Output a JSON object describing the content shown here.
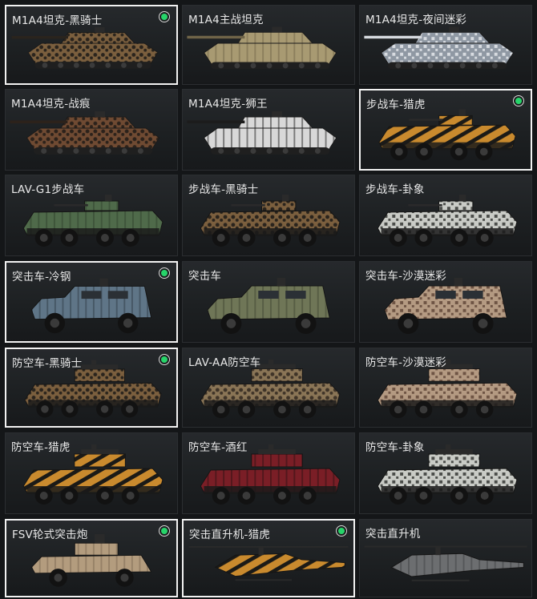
{
  "vehicles": [
    {
      "label": "M1A4坦克-黑骑士",
      "type": "tank",
      "camo": "desert-dark",
      "selected": true,
      "owned": true
    },
    {
      "label": "M1A4主战坦克",
      "type": "tank",
      "camo": "tan",
      "selected": false,
      "owned": false
    },
    {
      "label": "M1A4坦克-夜间迷彩",
      "type": "tank",
      "camo": "night",
      "selected": false,
      "owned": false
    },
    {
      "label": "M1A4坦克-战痕",
      "type": "tank",
      "camo": "scarred",
      "selected": false,
      "owned": false
    },
    {
      "label": "M1A4坦克-狮王",
      "type": "tank",
      "camo": "lion",
      "selected": false,
      "owned": false
    },
    {
      "label": "步战车-猎虎",
      "type": "ifv",
      "camo": "tiger",
      "selected": true,
      "owned": true
    },
    {
      "label": "LAV-G1步战车",
      "type": "ifv",
      "camo": "green",
      "selected": false,
      "owned": false
    },
    {
      "label": "步战车-黑骑士",
      "type": "ifv",
      "camo": "desert-dark",
      "selected": false,
      "owned": false
    },
    {
      "label": "步战车-卦象",
      "type": "ifv",
      "camo": "arctic",
      "selected": false,
      "owned": false
    },
    {
      "label": "突击车-冷钢",
      "type": "mrap",
      "camo": "steel",
      "selected": true,
      "owned": true
    },
    {
      "label": "突击车",
      "type": "mrap",
      "camo": "olive",
      "selected": false,
      "owned": false
    },
    {
      "label": "突击车-沙漠迷彩",
      "type": "mrap",
      "camo": "desert-digital",
      "selected": false,
      "owned": false
    },
    {
      "label": "防空车-黑骑士",
      "type": "aa",
      "camo": "desert-dark",
      "selected": true,
      "owned": true
    },
    {
      "label": "LAV-AA防空车",
      "type": "aa",
      "camo": "tan-worn",
      "selected": false,
      "owned": false
    },
    {
      "label": "防空车-沙漠迷彩",
      "type": "aa",
      "camo": "desert-digital",
      "selected": false,
      "owned": false
    },
    {
      "label": "防空车-猎虎",
      "type": "aa",
      "camo": "tiger",
      "selected": false,
      "owned": false
    },
    {
      "label": "防空车-酒红",
      "type": "aa",
      "camo": "wine",
      "selected": false,
      "owned": false
    },
    {
      "label": "防空车-卦象",
      "type": "aa",
      "camo": "arctic",
      "selected": false,
      "owned": false
    },
    {
      "label": "FSV轮式突击炮",
      "type": "fsv",
      "camo": "sand",
      "selected": true,
      "owned": true
    },
    {
      "label": "突击直升机-猎虎",
      "type": "heli",
      "camo": "tiger",
      "selected": true,
      "owned": true
    },
    {
      "label": "突击直升机",
      "type": "heli",
      "camo": "gray",
      "selected": false,
      "owned": false
    }
  ],
  "palette": {
    "selected_border": "#f2f2f2",
    "owned_dot": "#27d46a",
    "desert-dark": [
      "#7b5f3e",
      "#2a241d",
      "#a0845c"
    ],
    "tan": [
      "#a89a72",
      "#6f6448",
      "#cbbf98"
    ],
    "night": [
      "#8f98a3",
      "#d7dbe0",
      "#4a5058"
    ],
    "scarred": [
      "#6f4a32",
      "#2c221b",
      "#9a6f4a"
    ],
    "lion": [
      "#d8d8d8",
      "#1c1c1c",
      "#c02a2a"
    ],
    "tiger": [
      "#c98a2e",
      "#1b1a17",
      "#e0ad55"
    ],
    "green": [
      "#4f6a4a",
      "#2f3f2c",
      "#7f927a"
    ],
    "arctic": [
      "#c9cbc6",
      "#4b4d4a",
      "#8e908c"
    ],
    "steel": [
      "#5f7587",
      "#2d3944",
      "#8fa3b2"
    ],
    "olive": [
      "#6f7657",
      "#3f4432",
      "#8e9472"
    ],
    "desert-digital": [
      "#b49a82",
      "#6e5444",
      "#d8c7b2"
    ],
    "tan-worn": [
      "#8a7556",
      "#3f3428",
      "#b09876"
    ],
    "wine": [
      "#7a1e26",
      "#2a0f12",
      "#a8343d"
    ],
    "sand": [
      "#b39c7e",
      "#7a6650",
      "#d2c0a3"
    ],
    "gray": [
      "#6c6e70",
      "#3e4042",
      "#9a9c9e"
    ]
  }
}
